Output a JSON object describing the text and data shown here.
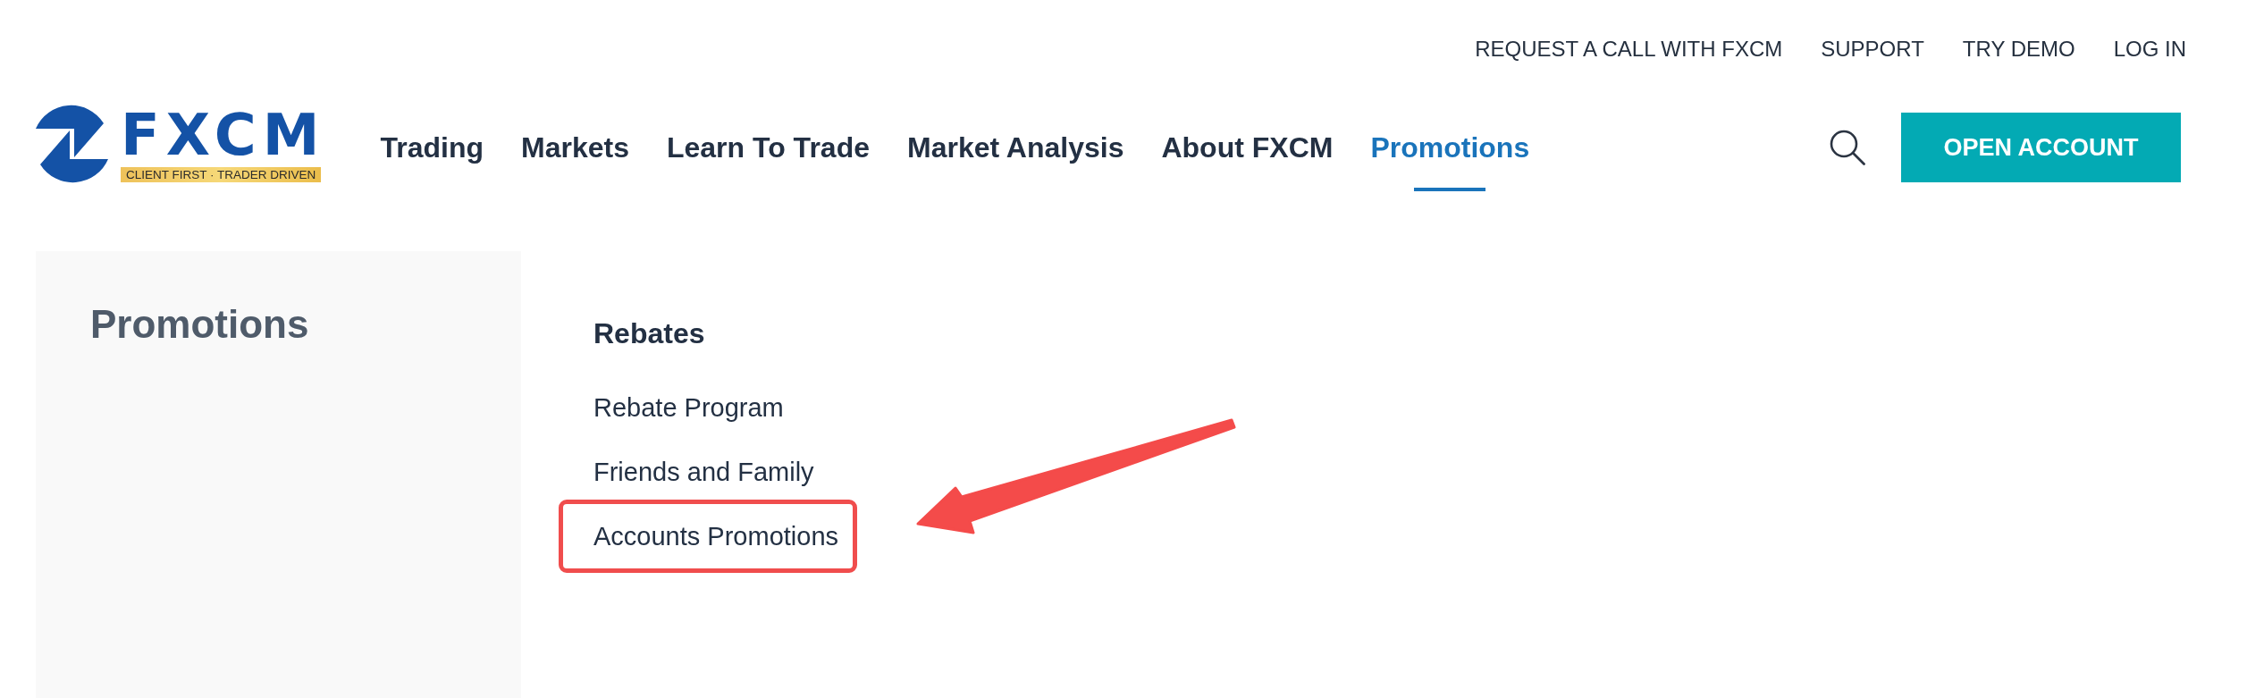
{
  "top_links": [
    "REQUEST A CALL WITH FXCM",
    "SUPPORT",
    "TRY DEMO",
    "LOG IN"
  ],
  "logo": {
    "wordmark": "FXCM",
    "tagline": "CLIENT FIRST · TRADER DRIVEN"
  },
  "nav": [
    {
      "label": "Trading",
      "selected": false
    },
    {
      "label": "Markets",
      "selected": false
    },
    {
      "label": "Learn To Trade",
      "selected": false
    },
    {
      "label": "Market Analysis",
      "selected": false
    },
    {
      "label": "About FXCM",
      "selected": false
    },
    {
      "label": "Promotions",
      "selected": true
    }
  ],
  "open_account_button": "OPEN ACCOUNT",
  "mega_menu": {
    "title": "Promotions",
    "group_title": "Rebates",
    "links": [
      {
        "label": "Rebate Program",
        "highlighted": false
      },
      {
        "label": "Friends and Family",
        "highlighted": false
      },
      {
        "label": "Accounts Promotions",
        "highlighted": true
      }
    ]
  }
}
